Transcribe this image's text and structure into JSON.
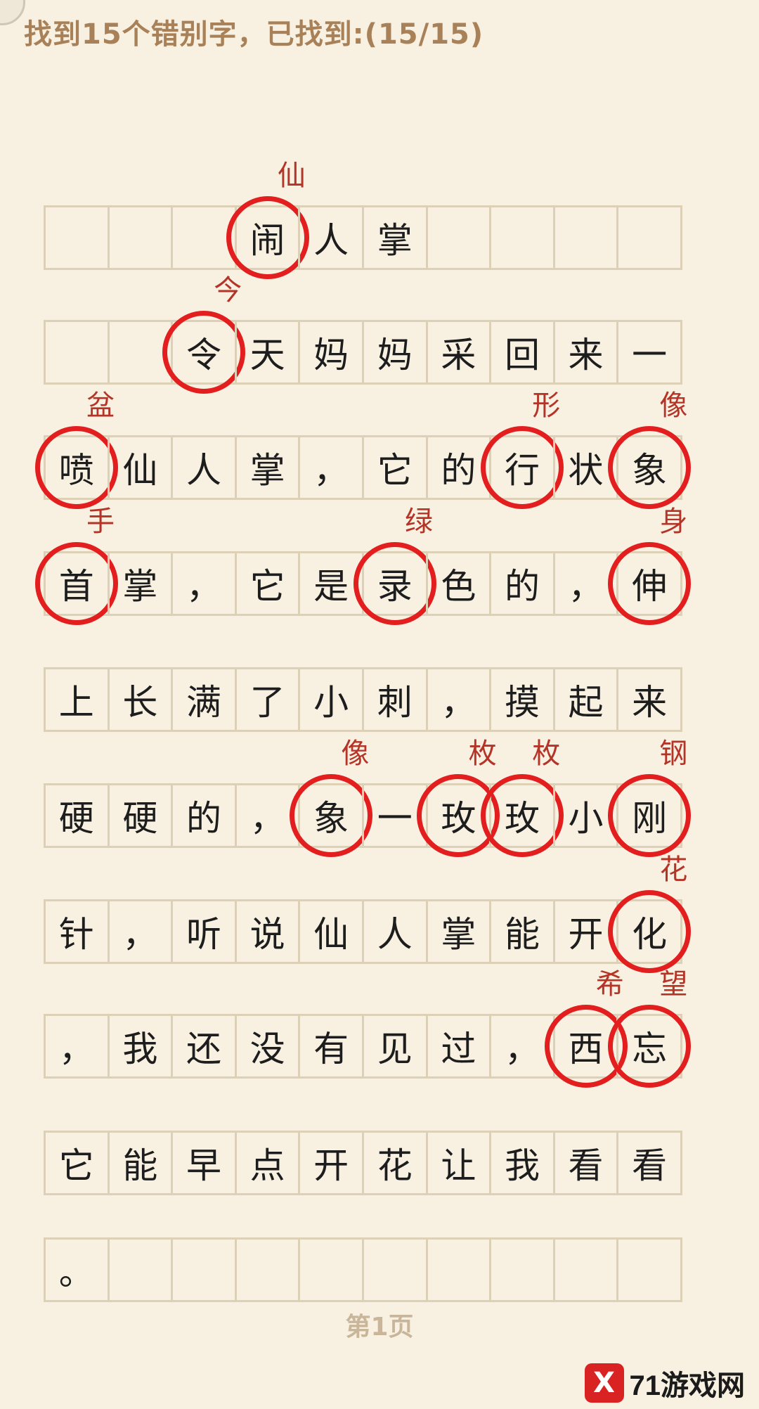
{
  "header": {
    "title": "找到15个错别字，已找到:(15/15)"
  },
  "page_label": "第1页",
  "watermark": {
    "logo_glyph": "X",
    "text": "71游戏网"
  },
  "grid": {
    "columns": 10,
    "rows": [
      [
        "",
        "",
        "",
        "闹",
        "人",
        "掌",
        "",
        "",
        "",
        ""
      ],
      [
        "",
        "",
        "令",
        "天",
        "妈",
        "妈",
        "采",
        "回",
        "来",
        "一"
      ],
      [
        "喷",
        "仙",
        "人",
        "掌",
        "，",
        "它",
        "的",
        "行",
        "状",
        "象"
      ],
      [
        "首",
        "掌",
        "，",
        "它",
        "是",
        "录",
        "色",
        "的",
        "，",
        "伸"
      ],
      [
        "上",
        "长",
        "满",
        "了",
        "小",
        "刺",
        "，",
        "摸",
        "起",
        "来"
      ],
      [
        "硬",
        "硬",
        "的",
        "，",
        "象",
        "一",
        "玫",
        "玫",
        "小",
        "刚"
      ],
      [
        "针",
        "，",
        "听",
        "说",
        "仙",
        "人",
        "掌",
        "能",
        "开",
        "化"
      ],
      [
        "，",
        "我",
        "还",
        "没",
        "有",
        "见",
        "过",
        "，",
        "西",
        "忘"
      ],
      [
        "它",
        "能",
        "早",
        "点",
        "开",
        "花",
        "让",
        "我",
        "看",
        "看"
      ],
      [
        "。",
        "",
        "",
        "",
        "",
        "",
        "",
        "",
        "",
        ""
      ]
    ]
  },
  "corrections": [
    {
      "row": 0,
      "col": 3,
      "wrong": "闹",
      "fix": "仙"
    },
    {
      "row": 1,
      "col": 2,
      "wrong": "令",
      "fix": "今"
    },
    {
      "row": 2,
      "col": 0,
      "wrong": "喷",
      "fix": "盆"
    },
    {
      "row": 2,
      "col": 7,
      "wrong": "行",
      "fix": "形"
    },
    {
      "row": 2,
      "col": 9,
      "wrong": "象",
      "fix": "像"
    },
    {
      "row": 3,
      "col": 0,
      "wrong": "首",
      "fix": "手"
    },
    {
      "row": 3,
      "col": 5,
      "wrong": "录",
      "fix": "绿"
    },
    {
      "row": 3,
      "col": 9,
      "wrong": "伸",
      "fix": "身"
    },
    {
      "row": 5,
      "col": 4,
      "wrong": "象",
      "fix": "像"
    },
    {
      "row": 5,
      "col": 6,
      "wrong": "玫",
      "fix": "枚"
    },
    {
      "row": 5,
      "col": 7,
      "wrong": "玫",
      "fix": "枚"
    },
    {
      "row": 5,
      "col": 9,
      "wrong": "刚",
      "fix": "钢"
    },
    {
      "row": 6,
      "col": 9,
      "wrong": "化",
      "fix": "花"
    },
    {
      "row": 7,
      "col": 8,
      "wrong": "西",
      "fix": "希"
    },
    {
      "row": 7,
      "col": 9,
      "wrong": "忘",
      "fix": "望"
    }
  ],
  "colors": {
    "circle": "#e31e1e",
    "fix_text": "#b53428",
    "title": "#a98158",
    "grid_line": "#dcd0b6",
    "background": "#f8f1e2"
  }
}
